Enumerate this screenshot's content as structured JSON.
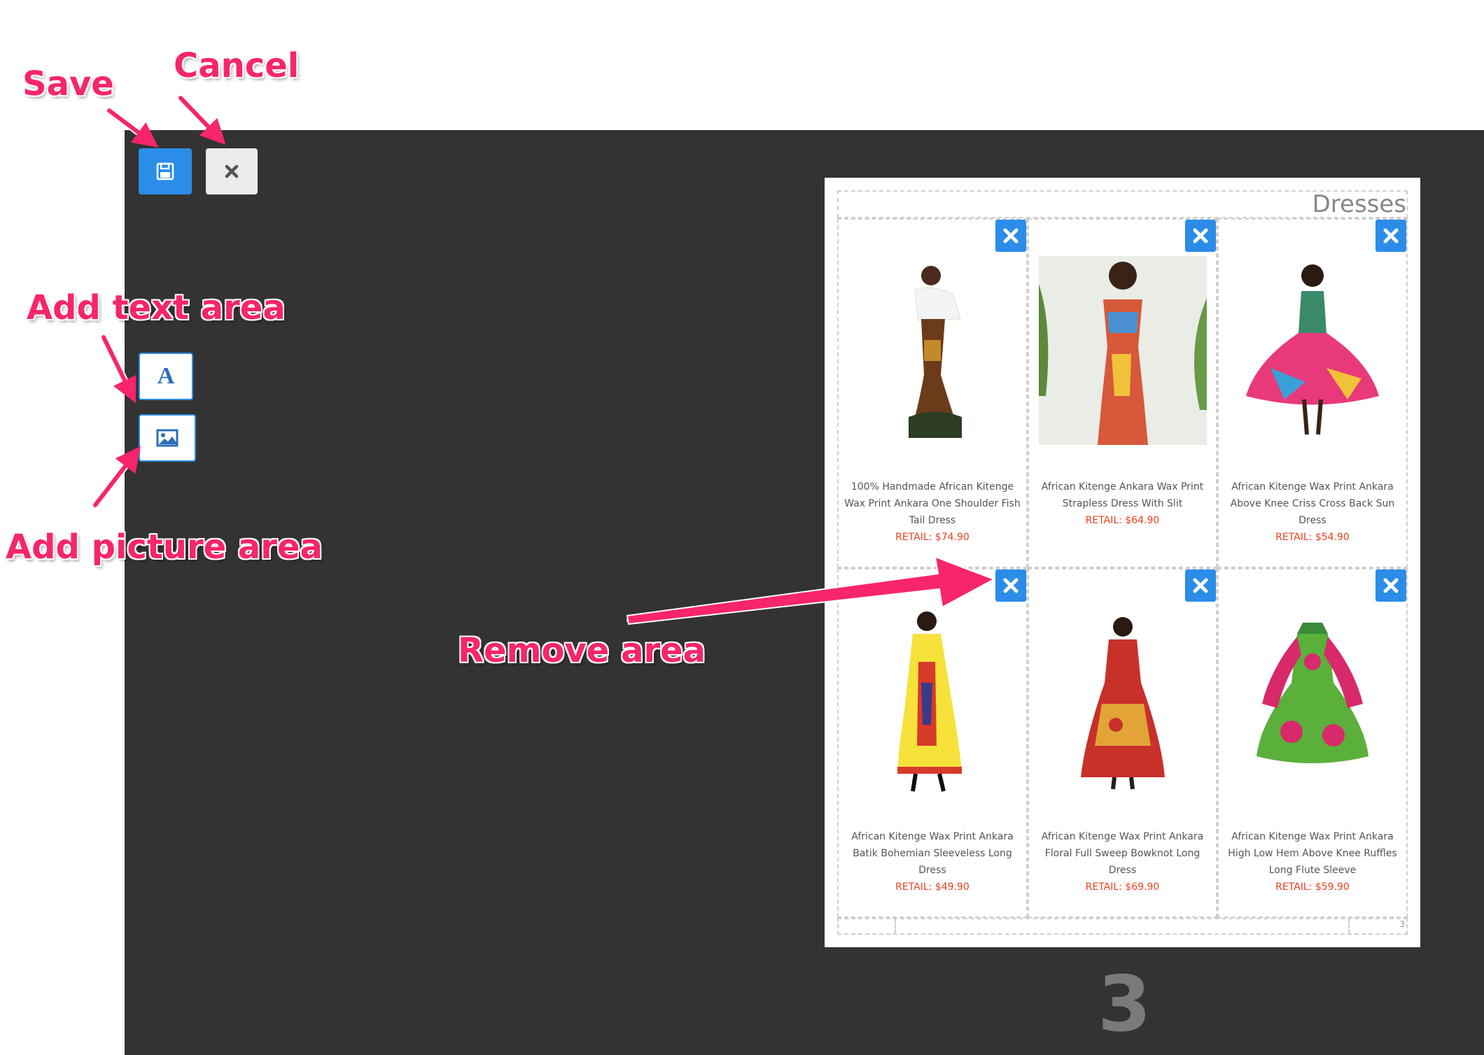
{
  "toolbar": {
    "save_icon": "floppy-disk-icon",
    "cancel_icon": "close-x-icon",
    "add_text_glyph": "A",
    "add_picture_icon": "picture-icon"
  },
  "annotations": {
    "save": "Save",
    "cancel": "Cancel",
    "add_text_area": "Add text area",
    "add_picture_area": "Add picture area",
    "remove_area": "Remove area"
  },
  "page": {
    "title": "Dresses",
    "corner_number": "3",
    "page_number": "3",
    "products": [
      {
        "name": "100% Handmade African Kitenge Wax Print Ankara One Shoulder Fish Tail Dress",
        "price": "RETAIL: $74.90"
      },
      {
        "name": "African Kitenge Ankara Wax Print Strapless Dress With Slit",
        "price": "RETAIL: $64.90"
      },
      {
        "name": "African Kitenge Wax Print Ankara Above Knee Criss Cross Back Sun Dress",
        "price": "RETAIL: $54.90"
      },
      {
        "name": "African Kitenge Wax Print Ankara Batik Bohemian Sleeveless Long Dress",
        "price": "RETAIL: $49.90"
      },
      {
        "name": "African Kitenge Wax Print Ankara Floral Full Sweep Bowknot Long Dress",
        "price": "RETAIL: $69.90"
      },
      {
        "name": "African Kitenge Wax Print Ankara High Low Hem Above Knee Ruffles Long Flute Sleeve",
        "price": "RETAIL: $59.90"
      }
    ]
  },
  "colors": {
    "accent": "#2b8de8",
    "editor_background": "#333333",
    "callout": "#f7256b",
    "price": "#e8401c"
  }
}
